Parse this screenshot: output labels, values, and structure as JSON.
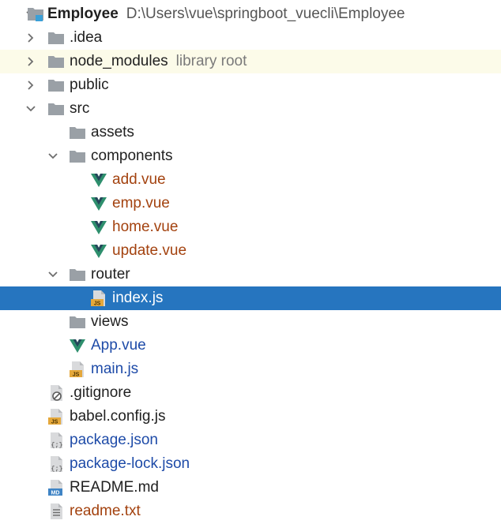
{
  "project": {
    "name": "Employee",
    "path": "D:\\Users\\vue\\springboot_vuecli\\Employee"
  },
  "rows": [
    {
      "label": ".idea"
    },
    {
      "label": "node_modules",
      "note": "library root"
    },
    {
      "label": "public"
    },
    {
      "label": "src"
    },
    {
      "label": "assets"
    },
    {
      "label": "components"
    },
    {
      "label": "add.vue"
    },
    {
      "label": "emp.vue"
    },
    {
      "label": "home.vue"
    },
    {
      "label": "update.vue"
    },
    {
      "label": "router"
    },
    {
      "label": "index.js"
    },
    {
      "label": "views"
    },
    {
      "label": "App.vue"
    },
    {
      "label": "main.js"
    },
    {
      "label": ".gitignore"
    },
    {
      "label": "babel.config.js"
    },
    {
      "label": "package.json"
    },
    {
      "label": "package-lock.json"
    },
    {
      "label": "README.md"
    },
    {
      "label": "readme.txt"
    }
  ],
  "icon_badges": {
    "js": "JS",
    "json": "{;}",
    "md": "MD"
  },
  "colors": {
    "selection": "#2675bf",
    "library_row": "#fcfbe9",
    "folder": "#9aa0a6",
    "vue_green": "#2e8f6d",
    "vue_dark": "#25455a",
    "modified_orange": "#a3420f",
    "added_blue": "#1e4ba8"
  }
}
